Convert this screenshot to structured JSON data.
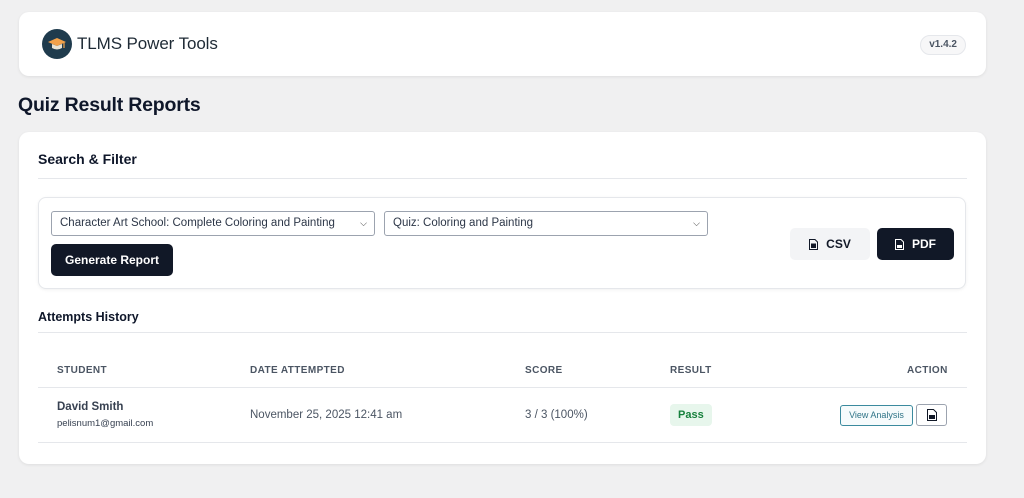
{
  "header": {
    "brand": "TLMS Power Tools",
    "version": "v1.4.2",
    "logo_icon": "graduation-cap-icon"
  },
  "page": {
    "title": "Quiz Result Reports"
  },
  "filter": {
    "section_title": "Search & Filter",
    "course_select": "Character Art School: Complete Coloring and Painting",
    "quiz_select": "Quiz: Coloring and Painting",
    "generate_label": "Generate Report",
    "csv_label": "CSV",
    "pdf_label": "PDF"
  },
  "attempts": {
    "title": "Attempts History",
    "columns": {
      "student": "STUDENT",
      "date": "DATE ATTEMPTED",
      "score": "SCORE",
      "result": "RESULT",
      "action": "ACTION"
    },
    "rows": [
      {
        "name": "David Smith",
        "email": "pelisnum1@gmail.com",
        "date": "November 25, 2025 12:41 am",
        "score": "3 / 3 (100%)",
        "result": "Pass",
        "action_label": "View Analysis"
      }
    ]
  },
  "colors": {
    "primary_dark": "#111827",
    "pass_bg": "#e7f6ec",
    "pass_text": "#16803c",
    "analysis_border": "#3b8a9e"
  }
}
